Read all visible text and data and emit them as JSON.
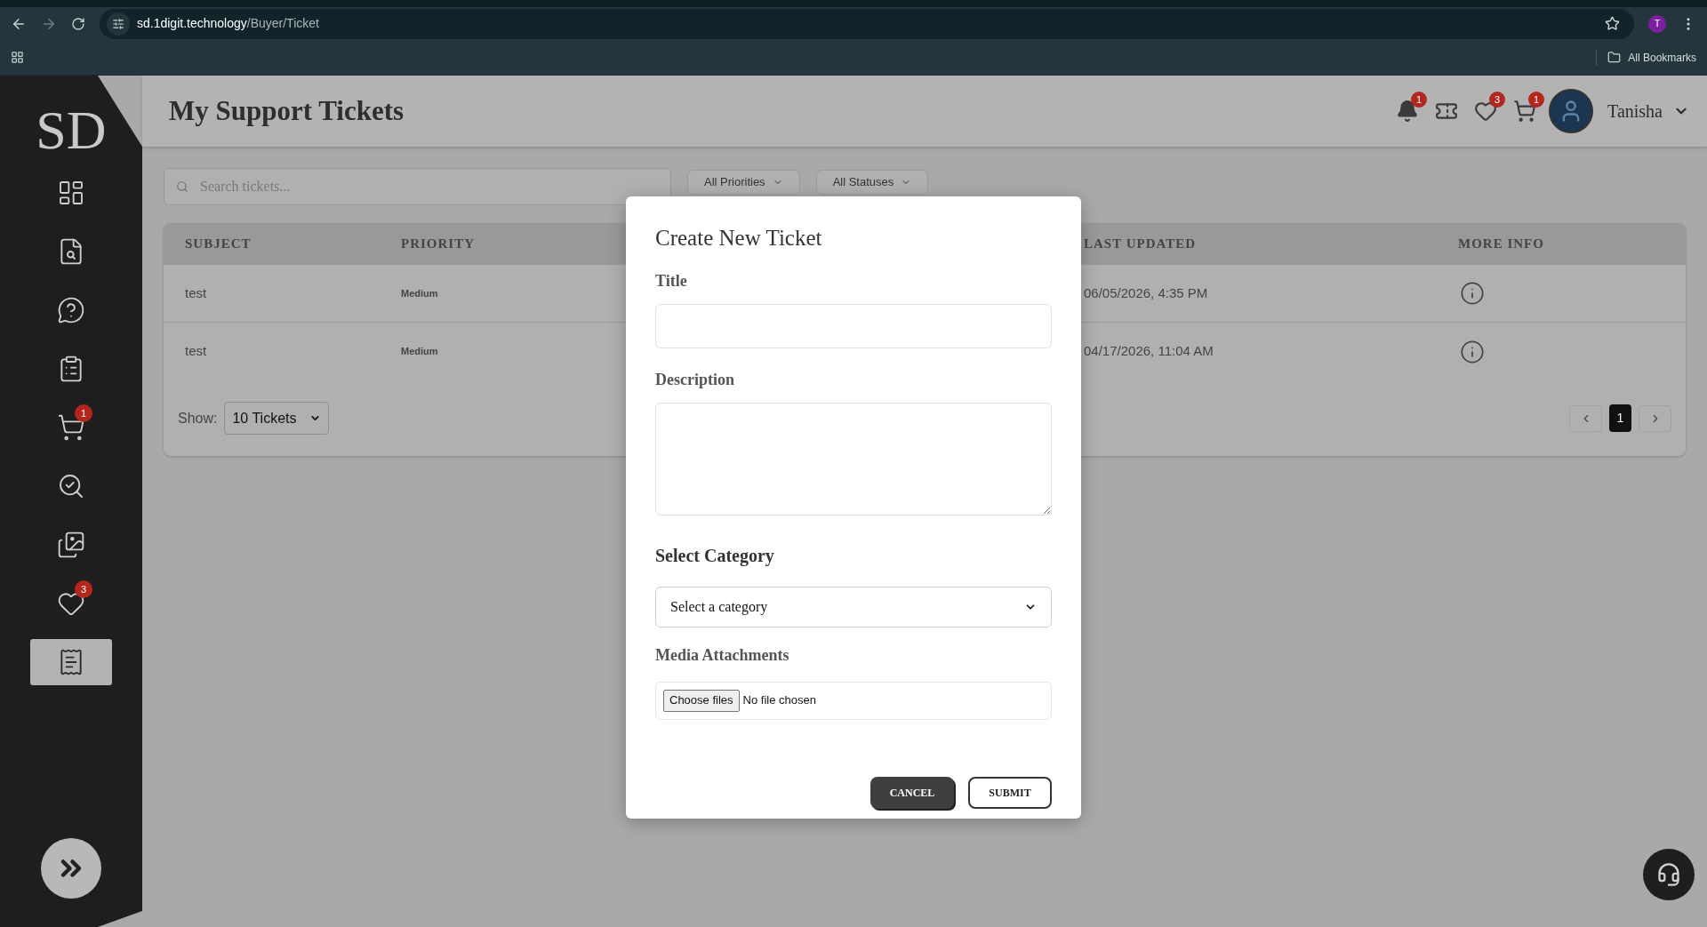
{
  "browser": {
    "url_host": "sd.1digit.technology",
    "url_path": "/Buyer/Ticket",
    "profile_initial": "T",
    "bookmarks_label": "All Bookmarks"
  },
  "logo": "SD",
  "sidebar": {
    "items": [
      {
        "selected": false
      },
      {
        "selected": false
      },
      {
        "selected": false
      },
      {
        "selected": false
      },
      {
        "selected": false,
        "badge": "1"
      },
      {
        "selected": false
      },
      {
        "selected": false
      },
      {
        "selected": false,
        "badge": "3"
      },
      {
        "selected": true
      }
    ]
  },
  "header": {
    "title": "My Support Tickets",
    "notification_badge": "1",
    "wishlist_badge": "3",
    "cart_badge": "1",
    "user_name": "Tanisha"
  },
  "filters": {
    "search_placeholder": "Search tickets...",
    "dropdowns": [
      "All Priorities",
      "All Statuses"
    ]
  },
  "table": {
    "columns": [
      "SUBJECT",
      "PRIORITY",
      "LAST UPDATED",
      "MORE INFO"
    ],
    "rows": [
      {
        "subject": "test",
        "priority": "Medium",
        "last_updated": "06/05/2026, 4:35 PM"
      },
      {
        "subject": "test",
        "priority": "Medium",
        "last_updated": "04/17/2026, 11:04 AM"
      }
    ],
    "show_label": "Show:",
    "page_size": "10 Tickets",
    "pages": [
      {
        "label": "1",
        "selected": true
      }
    ]
  },
  "modal": {
    "title": "Create New Ticket",
    "title_label": "Title",
    "description_label": "Description",
    "category_heading": "Select Category",
    "category_placeholder": "Select a category",
    "media_label": "Media Attachments",
    "file_button": "Choose files",
    "file_status": "No file chosen",
    "cancel": "CANCEL",
    "submit": "SUBMIT"
  }
}
